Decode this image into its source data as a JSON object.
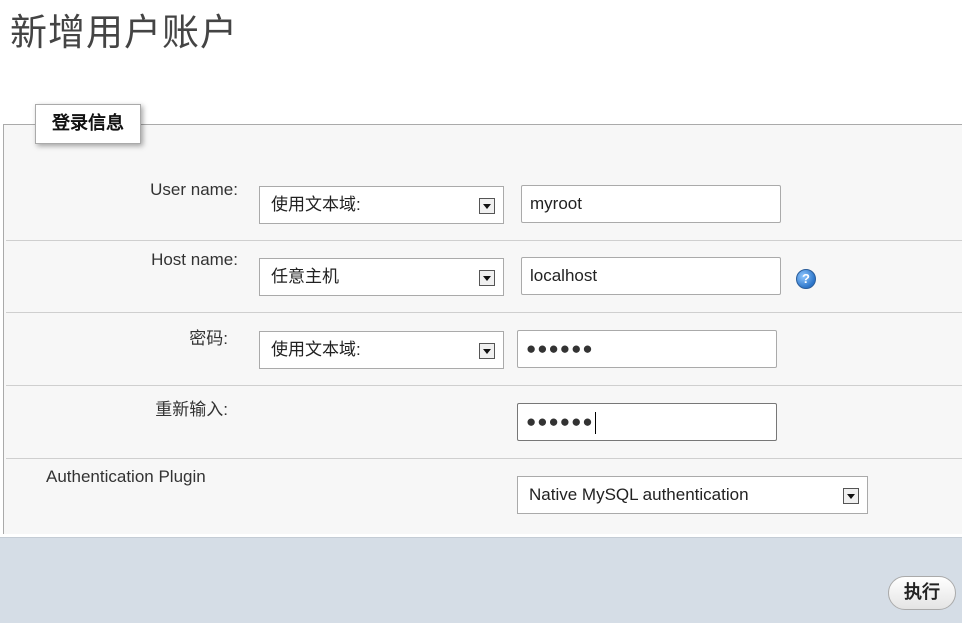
{
  "page_title": "新增用户账户",
  "fieldset": {
    "legend": "登录信息"
  },
  "rows": {
    "username": {
      "label": "User name:",
      "select_value": "使用文本域:",
      "input_value": "myroot"
    },
    "hostname": {
      "label": "Host name:",
      "select_value": "任意主机",
      "input_value": "localhost",
      "help_icon": "question-mark-icon"
    },
    "password": {
      "label": "密码:",
      "select_value": "使用文本域:",
      "input_value": "●●●●●●"
    },
    "retype": {
      "label": "重新输入:",
      "input_value": "●●●●●●"
    },
    "auth_plugin": {
      "label": "Authentication Plugin",
      "select_value": "Native MySQL authentication"
    }
  },
  "footer": {
    "submit_label": "执行"
  },
  "colors": {
    "fieldset_bg": "#f7f7f7",
    "footer_bg": "#d5dde6",
    "help_icon": "#2c75c9"
  }
}
